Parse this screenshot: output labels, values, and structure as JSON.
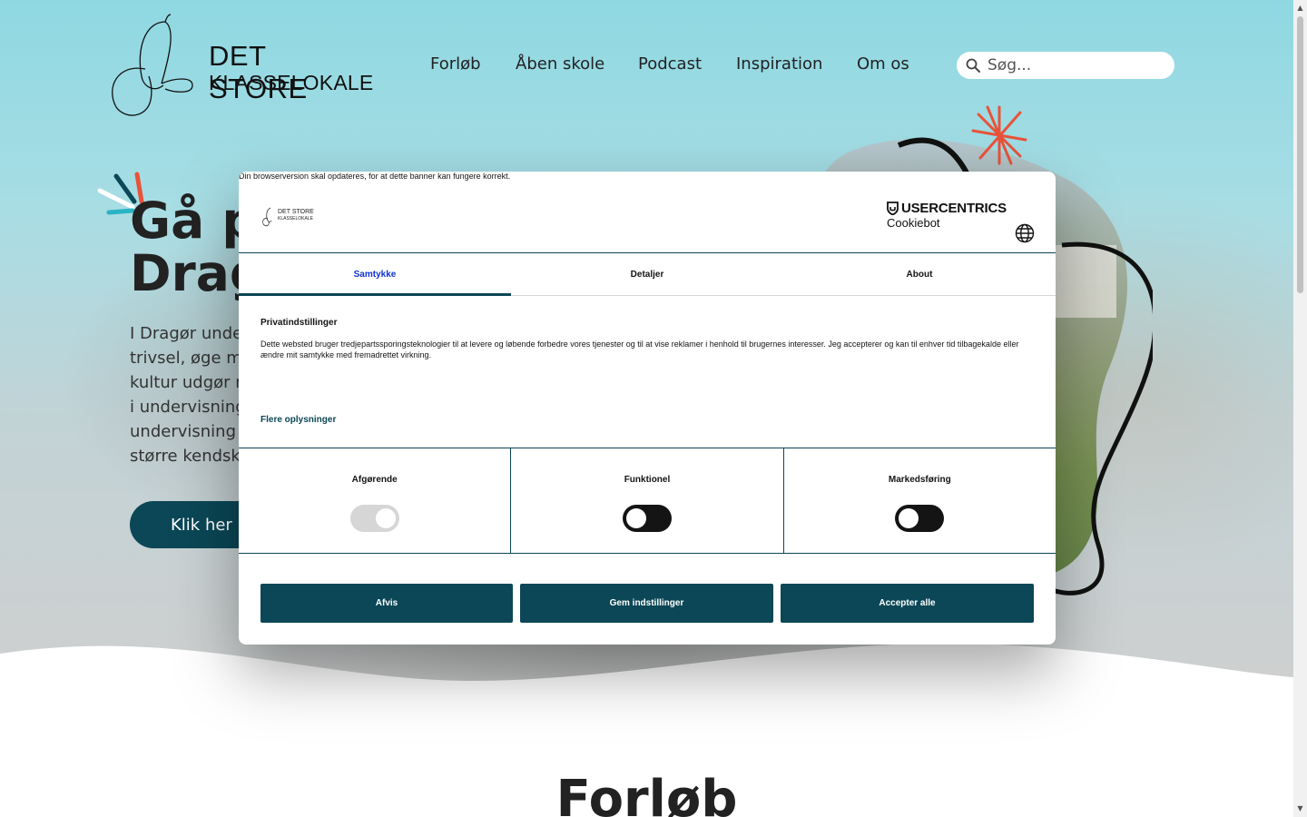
{
  "site": {
    "logo": {
      "line1": "DET STORE",
      "line2": "KLASSELOKALE"
    },
    "nav": [
      "Forløb",
      "Åben skole",
      "Podcast",
      "Inspiration",
      "Om os"
    ],
    "search": {
      "placeholder": "Søg..."
    },
    "hero": {
      "title_line1": "Gå p",
      "title_line2": "Drag",
      "body": [
        "I Dragør unde",
        "trivsel, øge m",
        "kultur udgør n",
        "i undervisning",
        "undervisning",
        "større kendsk"
      ],
      "cta": "Klik her"
    },
    "section_title": "Forløb"
  },
  "consent": {
    "warning": "Din browserversion skal opdateres, for at dette banner kan fungere korrekt.",
    "provider": {
      "brand": "USERCENTRICS",
      "product": "Cookiebot"
    },
    "dialog_logo": {
      "line1": "DET STORE",
      "line2": "KLASSELOKALE"
    },
    "tabs": [
      "Samtykke",
      "Detaljer",
      "About"
    ],
    "active_tab": "Samtykke",
    "privacy_title": "Privatindstillinger",
    "privacy_text": "Dette websted bruger tredjepartssporingsteknologier til at levere og løbende forbedre vores tjenester og til at vise reklamer i henhold til brugernes interesser. Jeg accepterer og kan til enhver tid tilbagekalde eller ændre mit samtykke med fremadrettet virkning.",
    "more_link": "Flere oplysninger",
    "categories": [
      {
        "label": "Afgørende",
        "enabled": true
      },
      {
        "label": "Funktionel",
        "enabled": false
      },
      {
        "label": "Markedsføring",
        "enabled": false
      }
    ],
    "buttons": {
      "reject": "Afvis",
      "save": "Gem indstillinger",
      "accept": "Accepter alle"
    }
  },
  "colors": {
    "primary": "#0b4756",
    "active_tab_text": "#1032cf",
    "accent_orange": "#e8533a"
  }
}
